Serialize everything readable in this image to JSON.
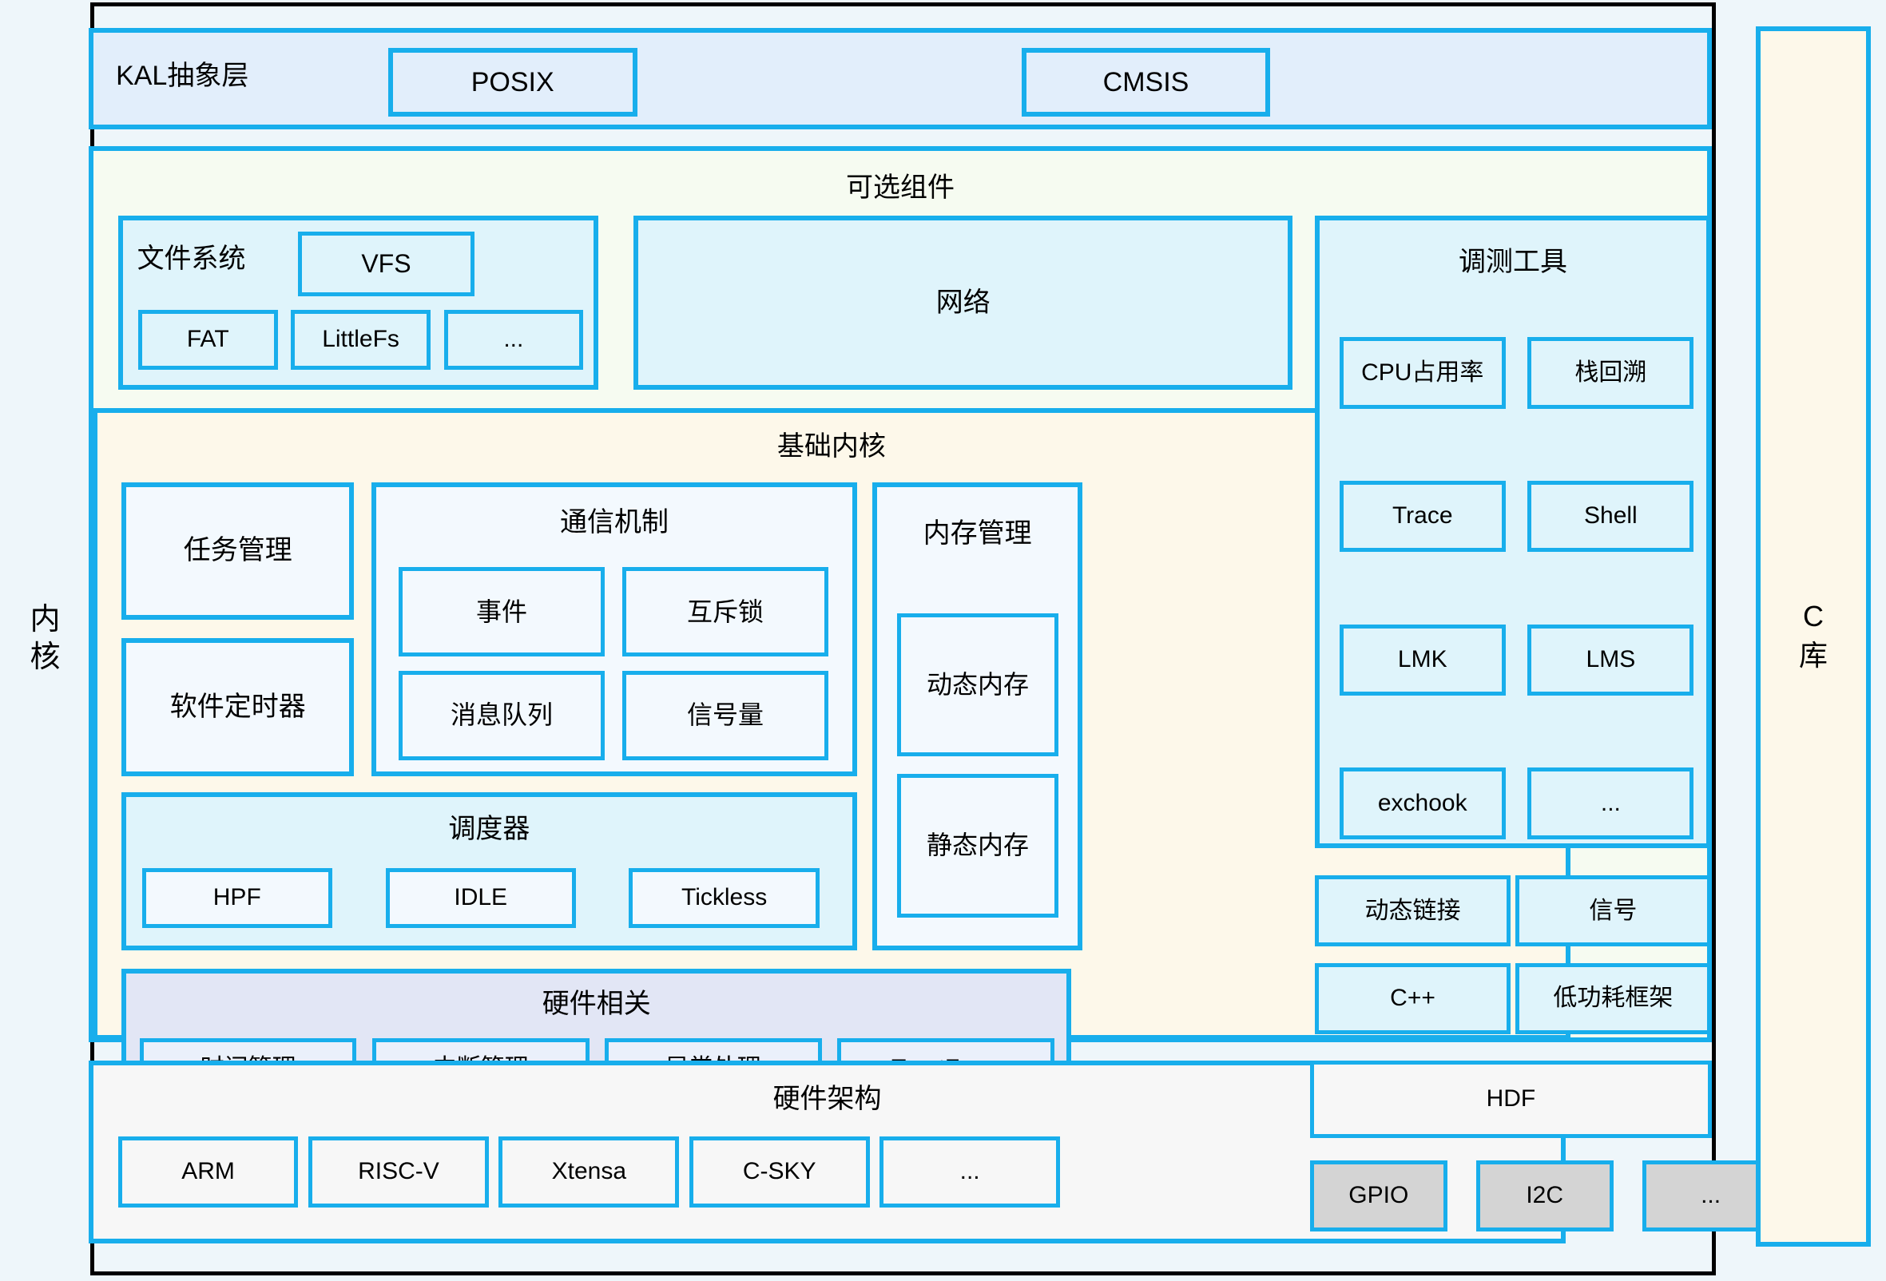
{
  "diagram": {
    "side_label_left": "内核",
    "side_label_right": "C库",
    "kal": {
      "title": "KAL抽象层",
      "items": [
        "POSIX",
        "CMSIS"
      ]
    },
    "optional": {
      "title": "可选组件",
      "filesystem": {
        "title": "文件系统",
        "vfs": "VFS",
        "items": [
          "FAT",
          "LittleFs",
          "..."
        ]
      },
      "network": "网络",
      "debug_tools": {
        "title": "调测工具",
        "items": [
          "CPU占用率",
          "栈回溯",
          "Trace",
          "Shell",
          "LMK",
          "LMS",
          "exchook",
          "..."
        ]
      },
      "extras": [
        "动态链接",
        "信号",
        "C++",
        "低功耗框架"
      ]
    },
    "base_kernel": {
      "title": "基础内核",
      "task_management": "任务管理",
      "software_timer": "软件定时器",
      "ipc": {
        "title": "通信机制",
        "items": [
          "事件",
          "互斥锁",
          "消息队列",
          "信号量"
        ]
      },
      "memory": {
        "title": "内存管理",
        "items": [
          "动态内存",
          "静态内存"
        ]
      },
      "scheduler": {
        "title": "调度器",
        "items": [
          "HPF",
          "IDLE",
          "Tickless"
        ]
      },
      "hardware_related": {
        "title": "硬件相关",
        "items": [
          "时间管理",
          "中断管理",
          "异常处理",
          "TrustZone"
        ]
      }
    },
    "hardware_arch": {
      "title": "硬件架构",
      "items": [
        "ARM",
        "RISC-V",
        "Xtensa",
        "C-SKY",
        "..."
      ]
    },
    "hdf": {
      "title": "HDF",
      "items": [
        "GPIO",
        "I2C",
        "..."
      ]
    },
    "colors": {
      "accent_border": "#18AEEC",
      "page_bg": "#eef6fa",
      "kal_fill": "#e2eefb",
      "optional_fill": "#f6fbf1",
      "cyan_fill": "#dff4fb",
      "cream_fill": "#fdf8ea",
      "lavender_fill": "#e2e6f5",
      "gray_fill": "#d4d4d4"
    }
  }
}
